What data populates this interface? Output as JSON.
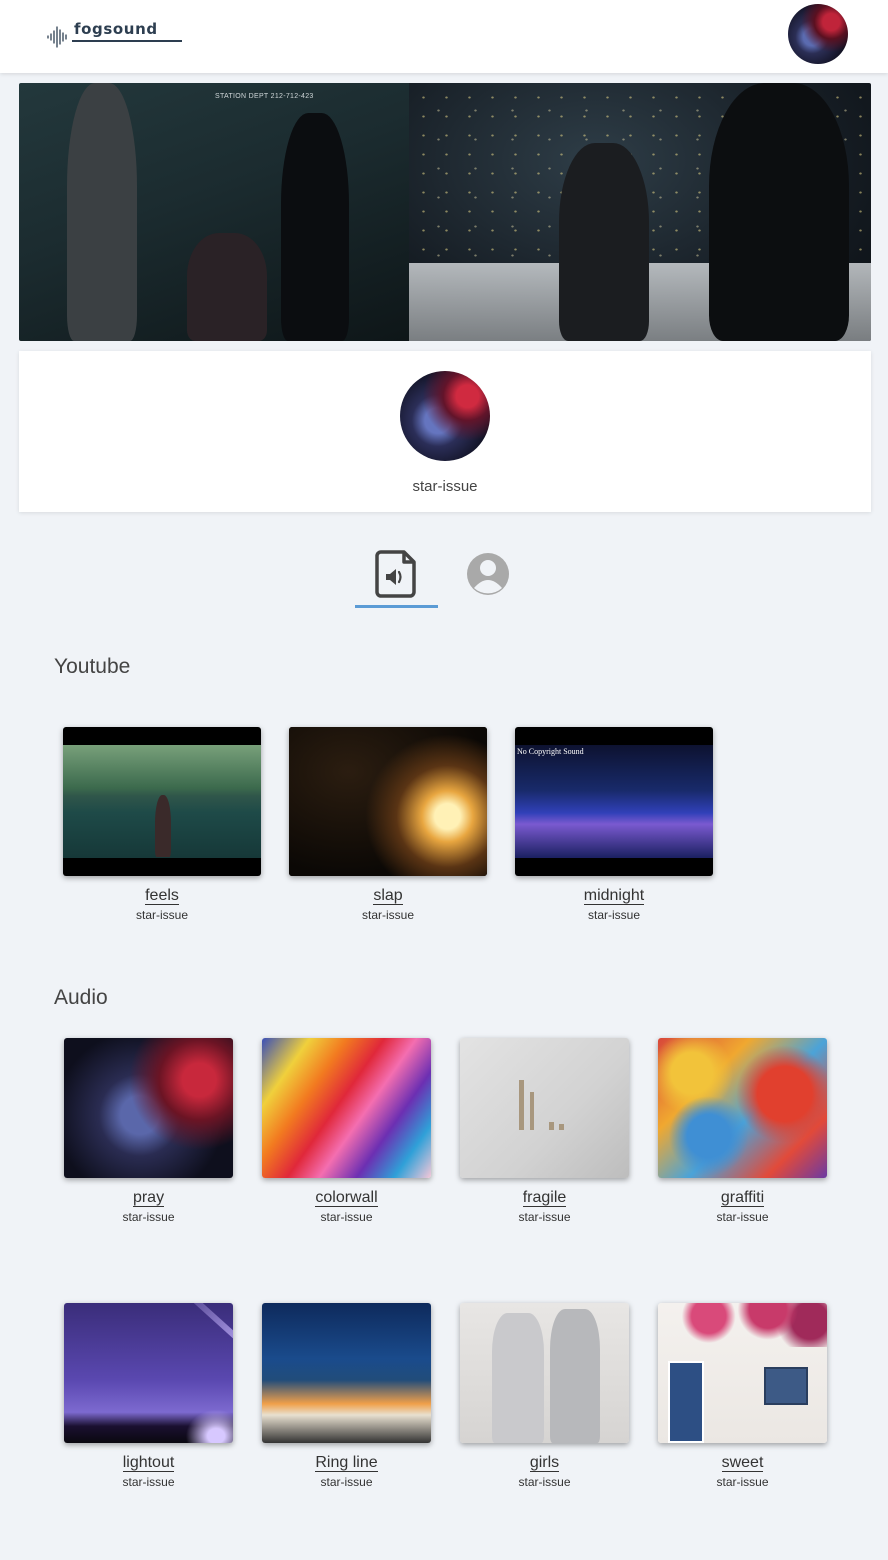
{
  "header": {
    "logo_text": "fogsound",
    "avatar_icon": "user-avatar-photo"
  },
  "banner": {
    "caption_text": "STATION DEPT 212-712-423"
  },
  "profile": {
    "username": "star-issue",
    "avatar_icon": "profile-avatar-photo"
  },
  "tabs": [
    {
      "icon": "audio-file-icon",
      "active": true
    },
    {
      "icon": "user-circle-icon",
      "active": false
    }
  ],
  "colors": {
    "background": "#f0f3f7",
    "accent": "#5b9bd5",
    "logo": "#2d3e50",
    "text": "#333333"
  },
  "sections": {
    "youtube": {
      "title": "Youtube",
      "items": [
        {
          "title": "feels",
          "author": "star-issue"
        },
        {
          "title": "slap",
          "author": "star-issue"
        },
        {
          "title": "midnight",
          "author": "star-issue",
          "thumb_label": "No Copyright Sound"
        }
      ]
    },
    "audio": {
      "title": "Audio",
      "items": [
        {
          "title": "pray",
          "author": "star-issue"
        },
        {
          "title": "colorwall",
          "author": "star-issue"
        },
        {
          "title": "fragile",
          "author": "star-issue"
        },
        {
          "title": "graffiti",
          "author": "star-issue"
        },
        {
          "title": "lightout",
          "author": "star-issue"
        },
        {
          "title": "Ring line",
          "author": "star-issue"
        },
        {
          "title": "girls",
          "author": "star-issue"
        },
        {
          "title": "sweet",
          "author": "star-issue"
        }
      ]
    }
  }
}
